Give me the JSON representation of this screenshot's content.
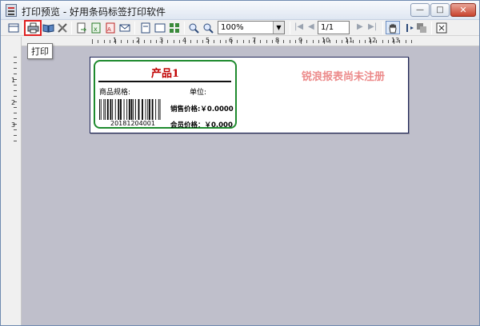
{
  "window": {
    "title": "打印预览 - 好用条码标签打印软件",
    "min_glyph": "—",
    "max_glyph": "□",
    "close_glyph": "✕"
  },
  "toolbar": {
    "zoom_value": "100%",
    "page_value": "1/1",
    "print_tooltip": "打印"
  },
  "rulers": {
    "h_labels": [
      "1",
      "2",
      "3",
      "4",
      "5",
      "6",
      "7",
      "8",
      "9",
      "10",
      "11",
      "12",
      "13"
    ],
    "v_labels": [
      "1",
      "2",
      "3"
    ]
  },
  "label": {
    "product_name": "产品1",
    "spec_label": "商品规格:",
    "unit_label": "单位:",
    "barcode_value": "20181204001",
    "sale_price": "销售价格:￥0.0000",
    "member_price": "会员价格：￥0.000"
  },
  "watermark": "锐浪报表尚未注册",
  "colors": {
    "label_border": "#1e8a2e",
    "product_name": "#c00000",
    "watermark": "#ec8a8a",
    "workspace_bg": "#bfbfcb"
  }
}
